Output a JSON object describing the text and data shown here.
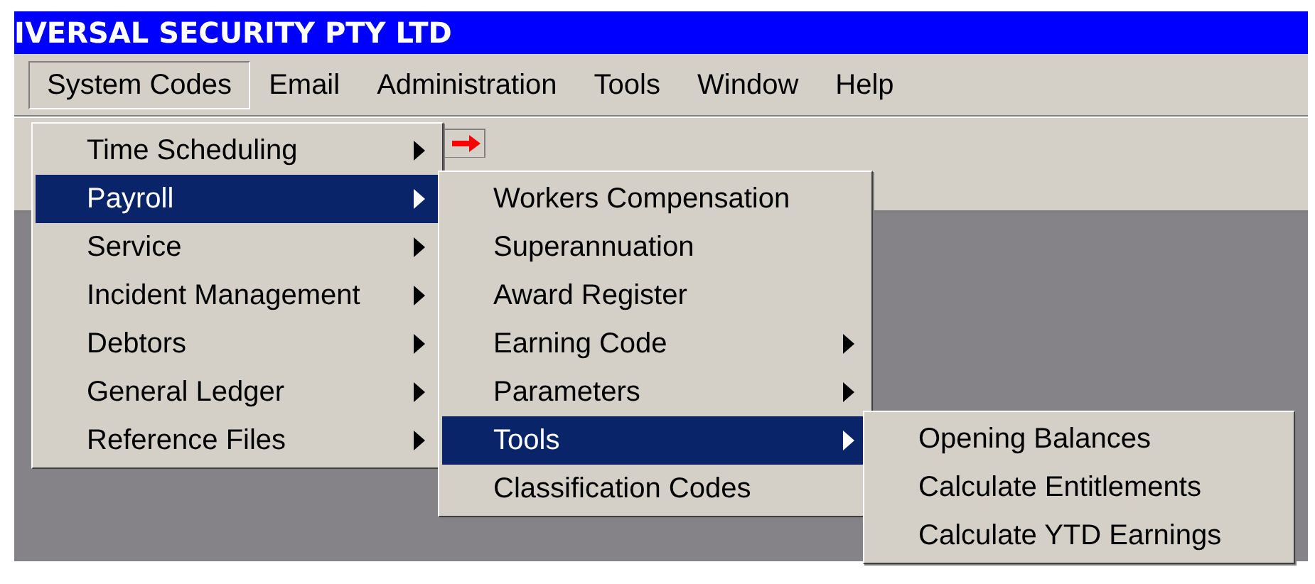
{
  "window": {
    "title": "IVERSAL SECURITY PTY LTD"
  },
  "menu_bar": [
    {
      "label": "System Codes",
      "selected": true
    },
    {
      "label": "Email",
      "selected": false
    },
    {
      "label": "Administration",
      "selected": false
    },
    {
      "label": "Tools",
      "selected": false
    },
    {
      "label": "Window",
      "selected": false
    },
    {
      "label": "Help",
      "selected": false
    }
  ],
  "menus": [
    {
      "items": [
        {
          "label": "Time Scheduling",
          "submenu": true,
          "selected": false
        },
        {
          "label": "Payroll",
          "submenu": true,
          "selected": true
        },
        {
          "label": "Service",
          "submenu": true,
          "selected": false
        },
        {
          "label": "Incident Management",
          "submenu": true,
          "selected": false
        },
        {
          "label": "Debtors",
          "submenu": true,
          "selected": false
        },
        {
          "label": "General Ledger",
          "submenu": true,
          "selected": false
        },
        {
          "label": "Reference Files",
          "submenu": true,
          "selected": false
        }
      ]
    },
    {
      "items": [
        {
          "label": "Workers Compensation",
          "submenu": false,
          "selected": false
        },
        {
          "label": "Superannuation",
          "submenu": false,
          "selected": false
        },
        {
          "label": "Award Register",
          "submenu": false,
          "selected": false
        },
        {
          "label": "Earning Code",
          "submenu": true,
          "selected": false
        },
        {
          "label": "Parameters",
          "submenu": true,
          "selected": false
        },
        {
          "label": "Tools",
          "submenu": true,
          "selected": true
        },
        {
          "label": "Classification Codes",
          "submenu": false,
          "selected": false
        }
      ]
    },
    {
      "items": [
        {
          "label": "Opening Balances",
          "submenu": false,
          "selected": false
        },
        {
          "label": "Calculate Entitlements",
          "submenu": false,
          "selected": false
        },
        {
          "label": "Calculate YTD Earnings",
          "submenu": false,
          "selected": false
        }
      ]
    }
  ]
}
